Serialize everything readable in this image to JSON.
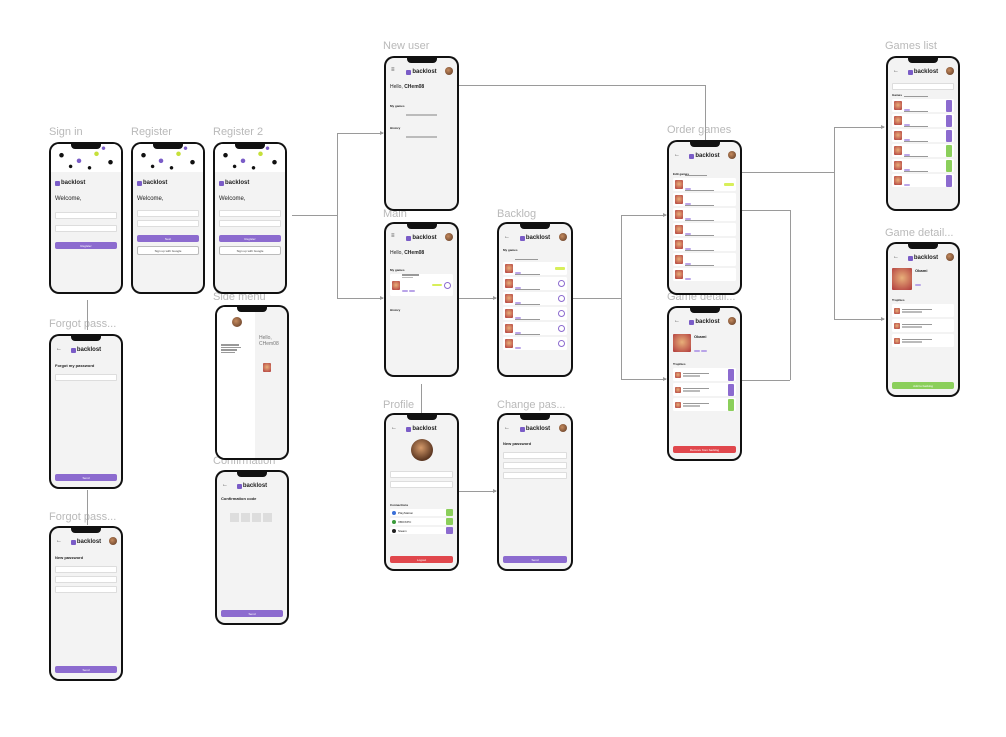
{
  "frames": {
    "sign_in": {
      "title": "Sign in",
      "heading": "Welcome,",
      "button": "Register"
    },
    "register": {
      "title": "Register",
      "heading": "Welcome,",
      "next": "Next",
      "google": "Sign up with Google"
    },
    "register2": {
      "title": "Register 2",
      "heading": "Welcome,",
      "button": "Register",
      "google": "Sign up with Google"
    },
    "forgot1": {
      "title": "Forgot pass...",
      "heading": "Forgot my password",
      "button": "Send"
    },
    "forgot2": {
      "title": "Forgot pass...",
      "heading": "New password",
      "button": "Send"
    },
    "side_menu": {
      "title": "Side menu",
      "greeting": "Hello, CHem08"
    },
    "confirmation": {
      "title": "Confirmation",
      "heading": "Confirmation code",
      "button": "Send"
    },
    "new_user": {
      "title": "New user",
      "greeting": "Hello, ",
      "name": "CHem08",
      "my_games": "My games",
      "history": "History"
    },
    "main": {
      "title": "Main",
      "greeting": "Hello, ",
      "name": "CHem08",
      "my_games": "My games",
      "history": "History"
    },
    "profile": {
      "title": "Profile",
      "connections": "Connections",
      "logout": "Logout",
      "items": [
        "PlayStation",
        "XBOX/PC",
        "Steam"
      ]
    },
    "backlog": {
      "title": "Backlog",
      "heading": "My games"
    },
    "change_pass": {
      "title": "Change pas...",
      "heading": "New password",
      "button": "Send"
    },
    "order_games": {
      "title": "Order games",
      "heading": "Edit games"
    },
    "game_detail_mid": {
      "title": "Game detail...",
      "game": "Obami",
      "trophies": "Trophies",
      "remove": "Remove from backlog"
    },
    "games_list": {
      "title": "Games list",
      "heading": "Games"
    },
    "game_detail_right": {
      "title": "Game detail...",
      "game": "Obami",
      "trophies": "Trophies",
      "add": "Add to backlog"
    }
  },
  "brand": {
    "logo": "backlost",
    "accent": "#8c6bcf",
    "lime": "#d8ef5a",
    "danger": "#e0474c",
    "success": "#8bcf5b"
  }
}
